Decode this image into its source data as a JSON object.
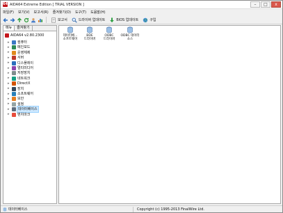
{
  "window": {
    "title": "AIDA64 Extreme Edition  [ TRIAL VERSION ]",
    "controls": [
      "–",
      "□",
      "x"
    ]
  },
  "menu": [
    "파일(F)",
    "보기(V)",
    "보고서(R)",
    "즐겨찾기(O)",
    "도구(T)",
    "도움말(H)"
  ],
  "toolbar": {
    "report_label": "보고서",
    "driver_update_label": "드라이버 업데이트",
    "bios_update_label": "BIOS 업데이트",
    "buy_label": "구입"
  },
  "left_pane": {
    "tabs": [
      "메뉴",
      "즐겨찾기"
    ],
    "root_label": "AIDA64 v2.80.2300",
    "items": [
      {
        "label": "컴퓨터",
        "color": "#3b78c4"
      },
      {
        "label": "메인보드",
        "color": "#2e8b57"
      },
      {
        "label": "운영체제",
        "color": "#e08a1e"
      },
      {
        "label": "서버",
        "color": "#c0392b"
      },
      {
        "label": "디스플레이",
        "color": "#2c6fbd"
      },
      {
        "label": "멀티미디어",
        "color": "#8e44ad"
      },
      {
        "label": "저장장치",
        "color": "#7f8c8d"
      },
      {
        "label": "네트워크",
        "color": "#16a085"
      },
      {
        "label": "DirectX",
        "color": "#d35400"
      },
      {
        "label": "장치",
        "color": "#34495e"
      },
      {
        "label": "소프트웨어",
        "color": "#2980b9"
      },
      {
        "label": "보안",
        "color": "#e67e22"
      },
      {
        "label": "설정",
        "color": "#95a5a6"
      },
      {
        "label": "데이터베이스",
        "color": "#5d6d7e",
        "selected": true
      },
      {
        "label": "벤치마크",
        "color": "#e74c3c"
      }
    ]
  },
  "right_pane": {
    "items": [
      {
        "label_line1": "데이터베...",
        "label_line2": "소프트웨어"
      },
      {
        "label_line1": "BDE",
        "label_line2": "드라이버"
      },
      {
        "label_line1": "ODBC",
        "label_line2": "드라이버"
      },
      {
        "label_line1": "ODBC 데이터",
        "label_line2": "소스"
      }
    ]
  },
  "status": {
    "left": "데이터베이스",
    "right": "Copyright (c) 1995-2013 FinalWire Ltd."
  },
  "colors": {
    "selection": "#cde8ff",
    "close_button": "#d9574b",
    "app_icon": "#c4161c"
  }
}
